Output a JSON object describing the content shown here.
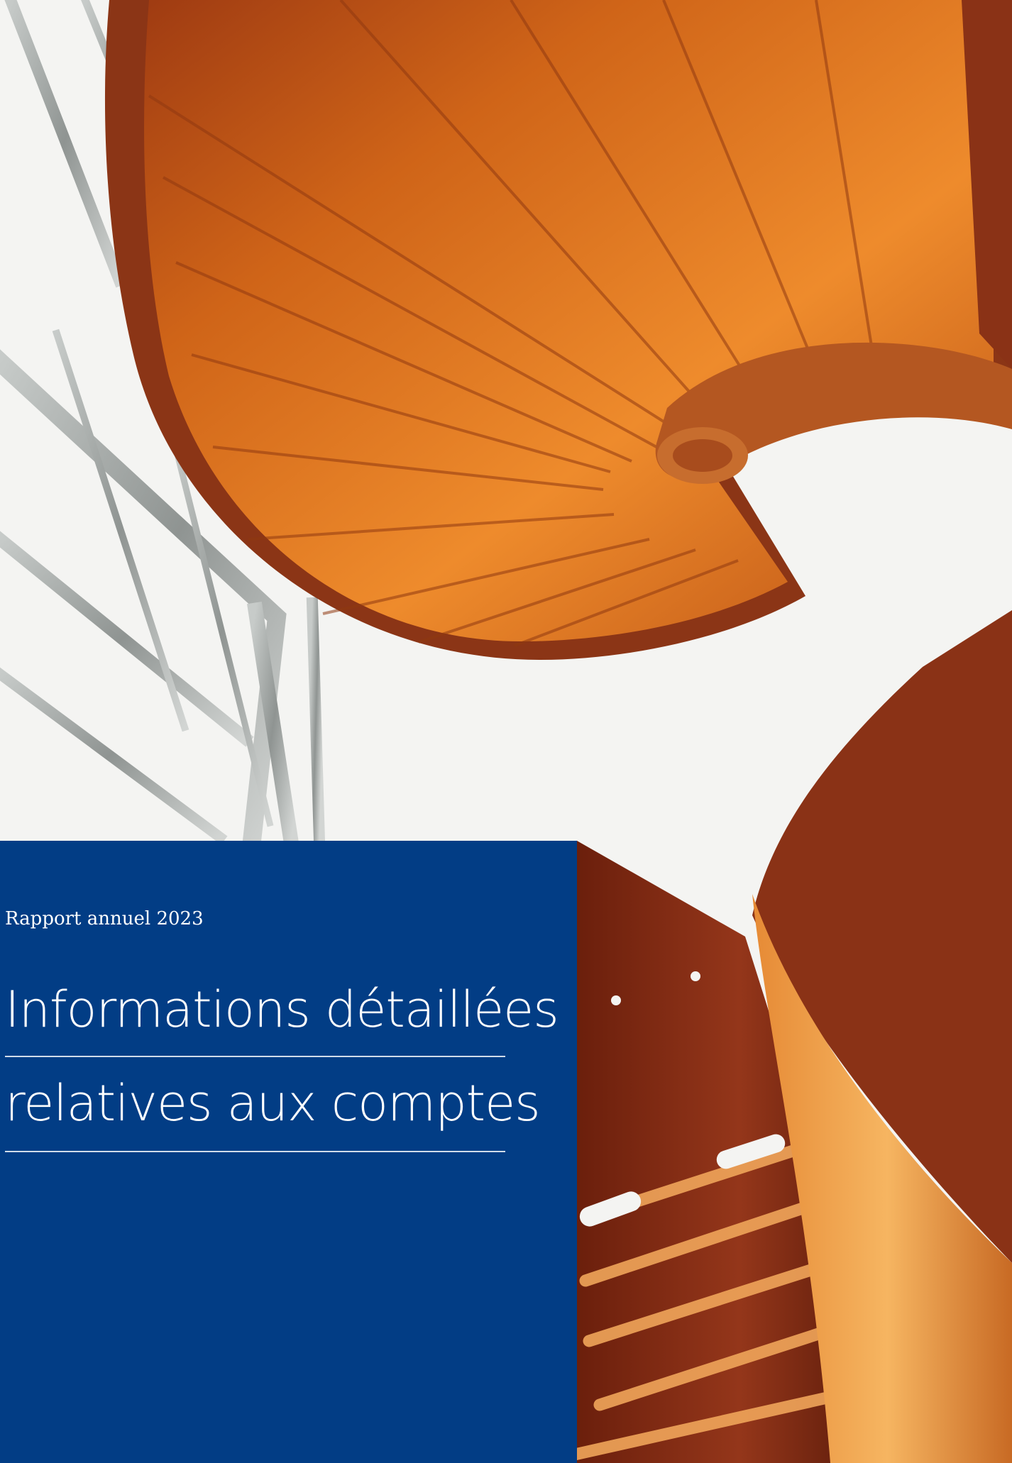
{
  "cover": {
    "photo": "spiral-staircase-photo",
    "brand_color": "#023d85",
    "report_label": "Rapport annuel 2023",
    "title_lines": [
      "Informations détaillées",
      "relatives aux comptes"
    ]
  }
}
